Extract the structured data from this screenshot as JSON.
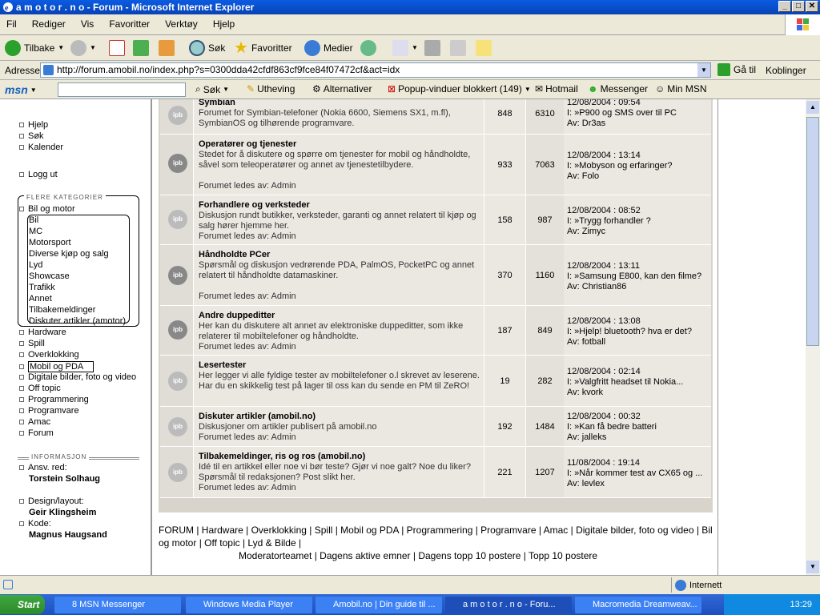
{
  "window": {
    "title": "a m o t o r . n o - Forum - Microsoft Internet Explorer"
  },
  "menu": [
    "Fil",
    "Rediger",
    "Vis",
    "Favoritter",
    "Verktøy",
    "Hjelp"
  ],
  "toolbar": {
    "back": "Tilbake",
    "search": "Søk",
    "favorites": "Favoritter",
    "media": "Medier"
  },
  "address": {
    "label": "Adresse",
    "url": "http://forum.amobil.no/index.php?s=0300dda42cfdf863cf9fce84f07472cf&act=idx",
    "go": "Gå til",
    "links": "Koblinger"
  },
  "msnbar": {
    "search": "Søk",
    "highlight": "Utheving",
    "alternatives": "Alternativer",
    "popup": "Popup-vinduer blokkert (149)",
    "hotmail": "Hotmail",
    "messenger": "Messenger",
    "minmsn": "Min MSN"
  },
  "sidebar": {
    "top": [
      "Hjelp",
      "Søk",
      "Kalender"
    ],
    "logout": "Logg ut",
    "section_title": "FLERE KATEGORIER",
    "group": "Bil og motor",
    "sub": [
      "Bil",
      "MC",
      "Motorsport",
      "Diverse kjøp og salg",
      "Lyd",
      "Showcase",
      "Trafikk",
      "Annet",
      "Tilbakemeldinger",
      "Diskuter artikler (amotor)"
    ],
    "cats": [
      "Hardware",
      "Spill",
      "Overklokking",
      "Mobil og PDA",
      "Digitale bilder, foto og video",
      "Off topic",
      "Programmering",
      "Programvare",
      "Amac",
      "Forum"
    ],
    "info_title": "INFORMASJON",
    "info": [
      {
        "label": "Ansv. red:",
        "name": "Torstein Solhaug"
      },
      {
        "label": "Design/layout:",
        "name": "Geir Klingsheim"
      },
      {
        "label": "Kode:",
        "name": "Magnus Haugsand"
      }
    ]
  },
  "forums": [
    {
      "title": "Symbian",
      "desc": "Forumet for Symbian-telefoner (Nokia 6600, Siemens SX1, m.fl), SymbianOS og tilhørende programvare.",
      "mod": "",
      "topics": "848",
      "posts": "6310",
      "date": "12/08/2004 : 09:54",
      "topic": "P900 og SMS over til PC",
      "by": "Av: Dr3as"
    },
    {
      "title": "Operatører og tjenester",
      "desc": "Stedet for å diskutere og spørre om tjenester for mobil og håndholdte, såvel som teleoperatører og annet av tjenestetilbydere.",
      "mod": "Forumet ledes av: Admin",
      "topics": "933",
      "posts": "7063",
      "date": "12/08/2004 : 13:14",
      "topic": "Mobyson og erfaringer?",
      "by": "Av: Folo"
    },
    {
      "title": "Forhandlere og verksteder",
      "desc": "Diskusjon rundt butikker, verksteder, garanti og annet relatert til kjøp og salg hører hjemme her.",
      "mod": "Forumet ledes av: Admin",
      "topics": "158",
      "posts": "987",
      "date": "12/08/2004 : 08:52",
      "topic": "Trygg forhandler ?",
      "by": "Av: Zimyc"
    },
    {
      "title": "Håndholdte PCer",
      "desc": "Spørsmål og diskusjon vedrørende PDA, PalmOS, PocketPC og annet relatert til håndholdte datamaskiner.",
      "mod": "Forumet ledes av: Admin",
      "topics": "370",
      "posts": "1160",
      "date": "12/08/2004 : 13:11",
      "topic": "Samsung E800, kan den filme?",
      "by": "Av: Christian86"
    },
    {
      "title": "Andre duppeditter",
      "desc": "Her kan du diskutere alt annet av elektroniske duppeditter, som ikke relaterer til mobiltelefoner og håndholdte.",
      "mod": "Forumet ledes av: Admin",
      "topics": "187",
      "posts": "849",
      "date": "12/08/2004 : 13:08",
      "topic": "Hjelp! bluetooth? hva er det?",
      "by": "Av: fotball"
    },
    {
      "title": "Lesertester",
      "desc": "Her legger vi alle fyldige tester av mobiltelefoner o.l skrevet av leserene. Har du en skikkelig test på lager til oss kan du sende en PM til ZeRO!",
      "mod": "",
      "topics": "19",
      "posts": "282",
      "date": "12/08/2004 : 02:14",
      "topic": "Valgfritt headset til Nokia...",
      "by": "Av: kvork"
    },
    {
      "title": "Diskuter artikler (amobil.no)",
      "desc": "Diskusjoner om artikler publisert på amobil.no",
      "mod": "Forumet ledes av: Admin",
      "topics": "192",
      "posts": "1484",
      "date": "12/08/2004 : 00:32",
      "topic": "Kan få bedre batteri",
      "by": "Av: jalleks"
    },
    {
      "title": "Tilbakemeldinger, ris og ros (amobil.no)",
      "desc": "Idé til en artikkel eller noe vi bør teste? Gjør vi noe galt? Noe du liker? Spørsmål til redaksjonen? Post slikt her.",
      "mod": "Forumet ledes av: Admin",
      "topics": "221",
      "posts": "1207",
      "date": "11/08/2004 : 19:14",
      "topic": "Når kommer test av CX65 og ...",
      "by": "Av: levlex"
    }
  ],
  "footer": {
    "line1": "FORUM | Hardware | Overklokking | Spill | Mobil og PDA | Programmering | Programvare | Amac | Digitale bilder, foto og video | Bil og motor | Off topic | Lyd & Bilde |",
    "line2": "Moderatorteamet | Dagens aktive emner | Dagens topp 10 postere | Topp 10 postere"
  },
  "status": {
    "zone": "Internett"
  },
  "taskbar": {
    "start": "Start",
    "tasks": [
      "8 MSN Messenger",
      "Windows Media Player",
      "Amobil.no | Din guide til ...",
      "a m o t o r . n o - Foru...",
      "Macromedia Dreamweav..."
    ],
    "clock": "13:29"
  }
}
